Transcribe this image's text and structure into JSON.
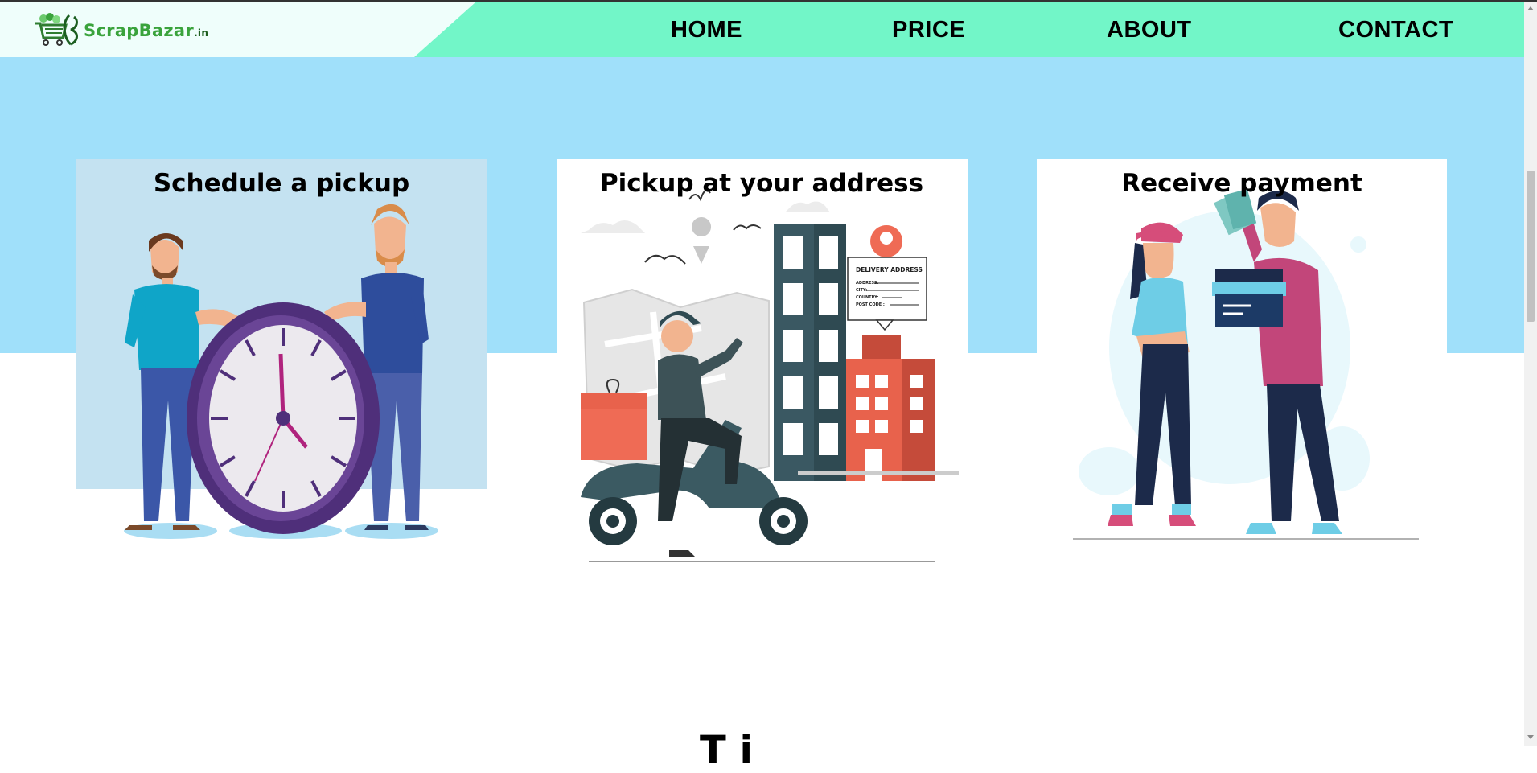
{
  "brand": {
    "name": "ScrapBazar",
    "suffix": ".in"
  },
  "nav": {
    "home": "HOME",
    "price": "PRICE",
    "about": "ABOUT",
    "contact": "CONTACT"
  },
  "steps": [
    {
      "title": "Schedule a pickup"
    },
    {
      "title": "Pickup at your address",
      "label_title": "DELIVERY ADDRESS",
      "label_lines": [
        "ADDRESS:",
        "CITY:",
        "COUNTRY:",
        "POST CODE :"
      ]
    },
    {
      "title": "Receive payment"
    }
  ],
  "next_section": {
    "heading_partial": "T i"
  },
  "colors": {
    "nav_bg": "#72f6c8",
    "hero_band": "#a0e0fa",
    "brand_green": "#3aa33c"
  }
}
